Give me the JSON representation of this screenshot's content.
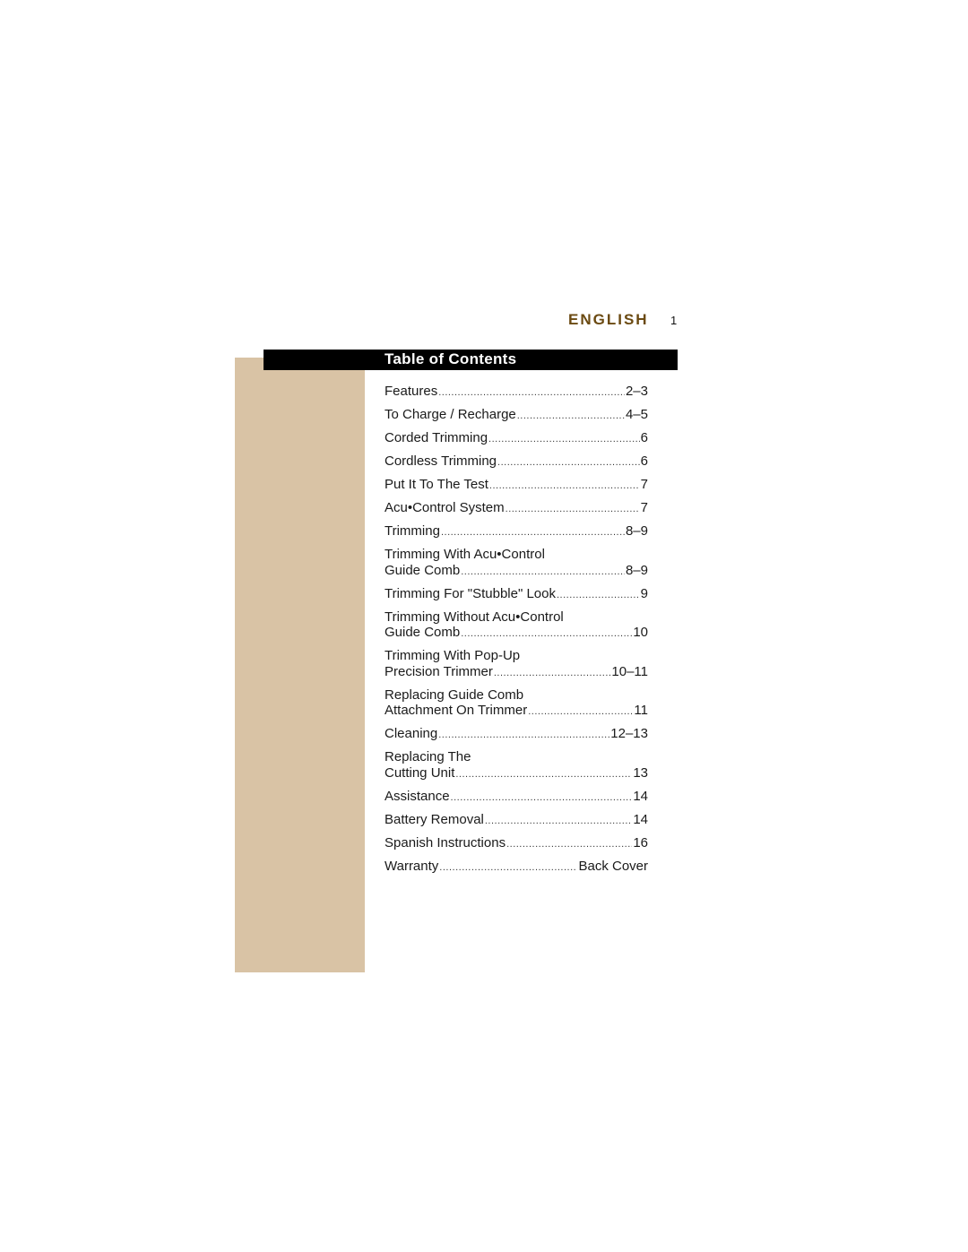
{
  "header": {
    "language": "ENGLISH",
    "page_number": "1"
  },
  "toc": {
    "title": "Table of Contents",
    "entries": [
      {
        "lines": [
          "Features"
        ],
        "page": "2–3"
      },
      {
        "lines": [
          "To Charge / Recharge"
        ],
        "page": "4–5"
      },
      {
        "lines": [
          "Corded Trimming"
        ],
        "page": "6"
      },
      {
        "lines": [
          "Cordless Trimming"
        ],
        "page": "6"
      },
      {
        "lines": [
          "Put It To The Test"
        ],
        "page": "7"
      },
      {
        "lines": [
          "Acu•Control System"
        ],
        "page": "7"
      },
      {
        "lines": [
          "Trimming"
        ],
        "page": "8–9"
      },
      {
        "lines": [
          "Trimming With Acu•Control",
          "Guide Comb"
        ],
        "page": "8–9"
      },
      {
        "lines": [
          "Trimming For \"Stubble\" Look"
        ],
        "page": "9"
      },
      {
        "lines": [
          "Trimming Without Acu•Control",
          "Guide Comb"
        ],
        "page": "10"
      },
      {
        "lines": [
          "Trimming With Pop-Up",
          "Precision Trimmer"
        ],
        "page": "10–11"
      },
      {
        "lines": [
          "Replacing Guide Comb",
          "Attachment On Trimmer"
        ],
        "page": "11"
      },
      {
        "lines": [
          "Cleaning"
        ],
        "page": "12–13"
      },
      {
        "lines": [
          "Replacing The",
          "Cutting Unit"
        ],
        "page": "13"
      },
      {
        "lines": [
          "Assistance"
        ],
        "page": "14"
      },
      {
        "lines": [
          "Battery Removal"
        ],
        "page": "14"
      },
      {
        "lines": [
          "Spanish Instructions"
        ],
        "page": "16"
      },
      {
        "lines": [
          "Warranty"
        ],
        "page": "Back Cover"
      }
    ]
  },
  "colors": {
    "accent_tan": "#d9c3a5",
    "language_brown": "#6b4a12",
    "title_bar": "#000000"
  }
}
